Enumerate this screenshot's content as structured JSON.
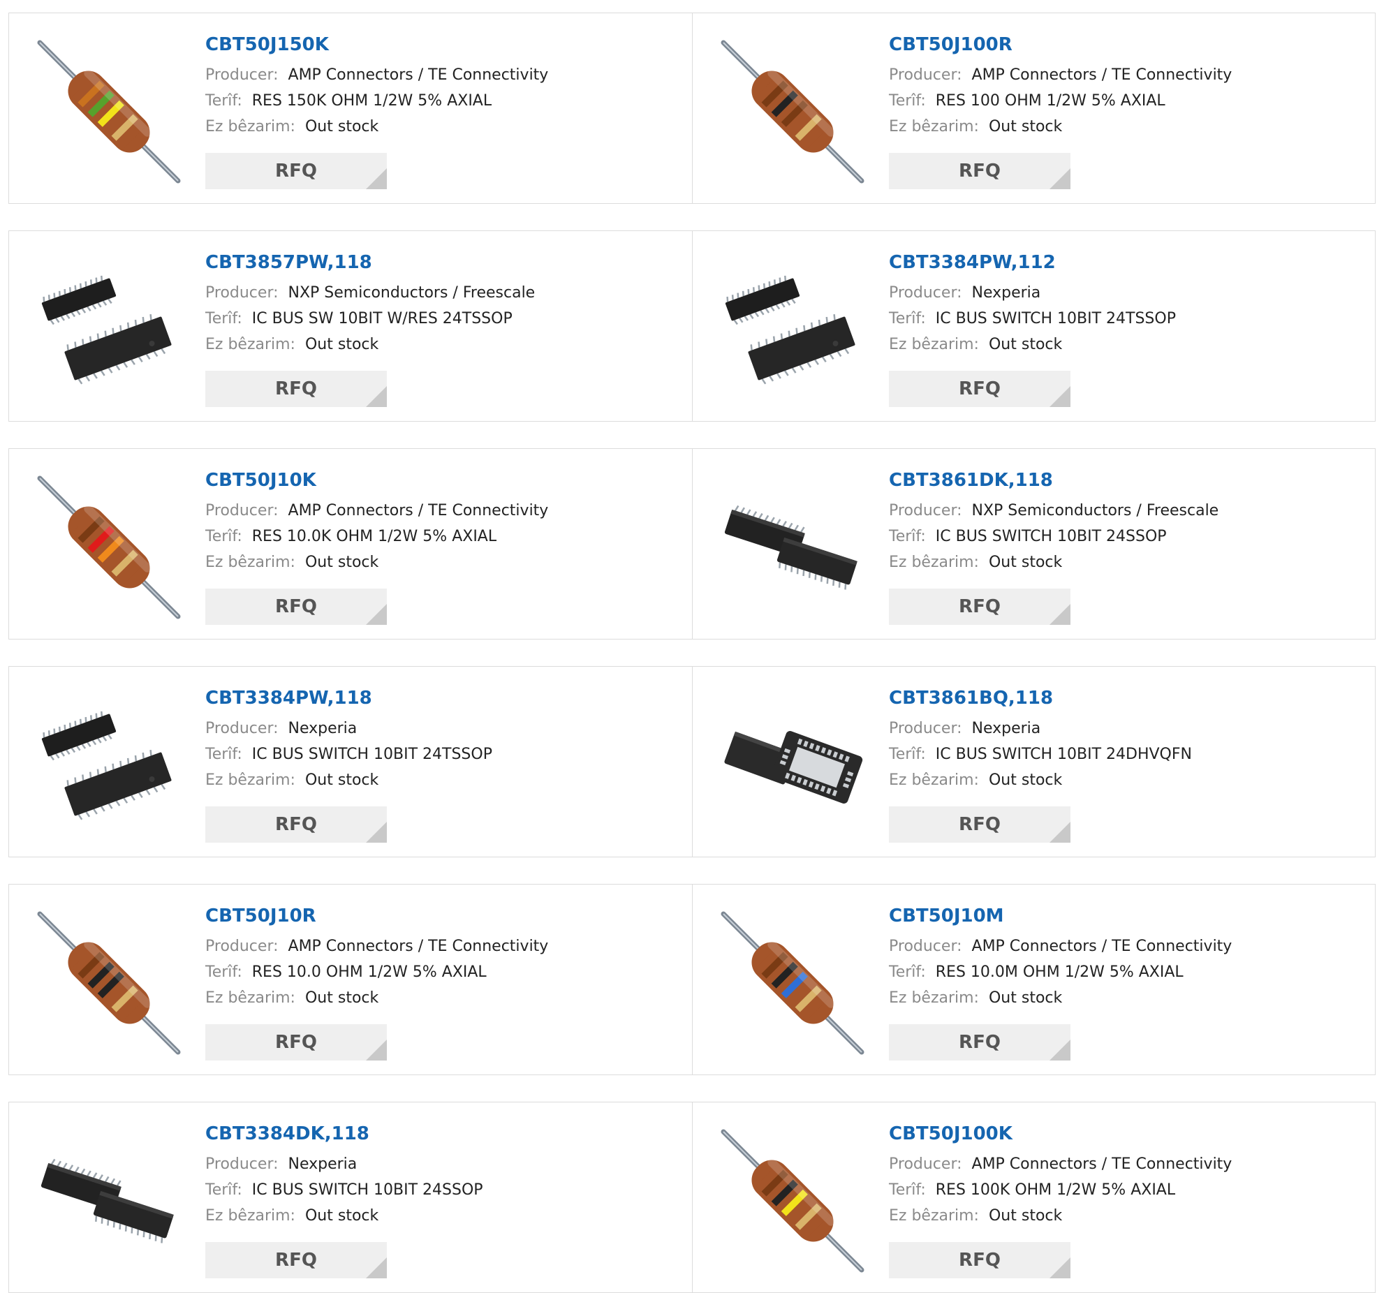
{
  "labels": {
    "producer": "Producer:",
    "description": "Terîf:",
    "stock": "Ez bêzarim:",
    "rfq": "RFQ"
  },
  "products": [
    {
      "part": "CBT50J150K",
      "producer": "AMP Connectors / TE Connectivity",
      "description": "RES 150K OHM 1/2W 5% AXIAL",
      "stock": "Out stock",
      "image": "resistor-image",
      "bands": [
        "#c9721f",
        "#57a12c",
        "#f2e31a",
        "#d9b36a"
      ]
    },
    {
      "part": "CBT50J100R",
      "producer": "AMP Connectors / TE Connectivity",
      "description": "RES 100 OHM 1/2W 5% AXIAL",
      "stock": "Out stock",
      "image": "resistor-image",
      "bands": [
        "#7a3b14",
        "#222222",
        "#7a3b14",
        "#d9b36a"
      ]
    },
    {
      "part": "CBT3857PW,118",
      "producer": "NXP Semiconductors / Freescale",
      "description": "IC BUS SW 10BIT W/RES 24TSSOP",
      "stock": "Out stock",
      "image": "tssop-chip-image"
    },
    {
      "part": "CBT3384PW,112",
      "producer": "Nexperia",
      "description": "IC BUS SWITCH 10BIT 24TSSOP",
      "stock": "Out stock",
      "image": "tssop-chip-image"
    },
    {
      "part": "CBT50J10K",
      "producer": "AMP Connectors / TE Connectivity",
      "description": "RES 10.0K OHM 1/2W 5% AXIAL",
      "stock": "Out stock",
      "image": "resistor-image",
      "bands": [
        "#7a3b14",
        "#e01b1b",
        "#f08a1c",
        "#d9b36a"
      ]
    },
    {
      "part": "CBT3861DK,118",
      "producer": "NXP Semiconductors / Freescale",
      "description": "IC BUS SWITCH 10BIT 24SSOP",
      "stock": "Out stock",
      "image": "ssop-chip-image"
    },
    {
      "part": "CBT3384PW,118",
      "producer": "Nexperia",
      "description": "IC BUS SWITCH 10BIT 24TSSOP",
      "stock": "Out stock",
      "image": "tssop-chip-image"
    },
    {
      "part": "CBT3861BQ,118",
      "producer": "Nexperia",
      "description": "IC BUS SWITCH 10BIT 24DHVQFN",
      "stock": "Out stock",
      "image": "qfn-chip-image"
    },
    {
      "part": "CBT50J10R",
      "producer": "AMP Connectors / TE Connectivity",
      "description": "RES 10.0 OHM 1/2W 5% AXIAL",
      "stock": "Out stock",
      "image": "resistor-image",
      "bands": [
        "#7a3b14",
        "#222222",
        "#222222",
        "#d9b36a"
      ]
    },
    {
      "part": "CBT50J10M",
      "producer": "AMP Connectors / TE Connectivity",
      "description": "RES 10.0M OHM 1/2W 5% AXIAL",
      "stock": "Out stock",
      "image": "resistor-image",
      "bands": [
        "#7a3b14",
        "#222222",
        "#2f6fd6",
        "#d9b36a"
      ]
    },
    {
      "part": "CBT3384DK,118",
      "producer": "Nexperia",
      "description": "IC BUS SWITCH 10BIT 24SSOP",
      "stock": "Out stock",
      "image": "ssop-chip-image"
    },
    {
      "part": "CBT50J100K",
      "producer": "AMP Connectors / TE Connectivity",
      "description": "RES 100K OHM 1/2W 5% AXIAL",
      "stock": "Out stock",
      "image": "resistor-image",
      "bands": [
        "#7a3b14",
        "#222222",
        "#f2e31a",
        "#d9b36a"
      ]
    }
  ],
  "colors": {
    "part_link": "#1565b0",
    "label": "#8a8a8a",
    "value": "#222222",
    "border": "#dcdcdc",
    "rfq_bg": "#efefef",
    "rfq_text": "#555555",
    "resistor_body": "#a5552a"
  }
}
